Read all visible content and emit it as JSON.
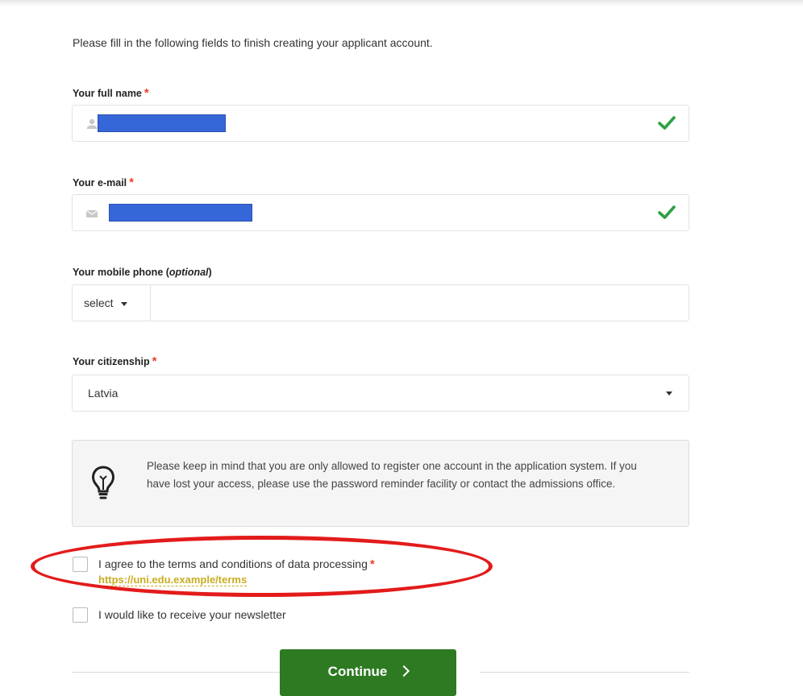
{
  "intro": "Please fill in the following fields to finish creating your applicant account.",
  "required_mark": "*",
  "fullname": {
    "label": "Your full name",
    "status_icon": "check-icon",
    "field_icon": "user-icon"
  },
  "email": {
    "label": "Your e-mail",
    "status_icon": "check-icon",
    "field_icon": "envelope-icon"
  },
  "phone": {
    "label": "Your mobile phone (",
    "label_optional": "optional",
    "label_close": ")",
    "code_select": "select",
    "value": ""
  },
  "citizenship": {
    "label": "Your citizenship",
    "value": "Latvia"
  },
  "info": {
    "icon": "lightbulb-icon",
    "text": "Please keep in mind that you are only allowed to register one account in the application system. If you have lost your access, please use the password reminder facility or contact the admissions office."
  },
  "terms": {
    "label": "I agree to the terms and conditions of data processing",
    "link": "https://uni.edu.example/terms",
    "checked": false
  },
  "newsletter": {
    "label": "I would like to receive your newsletter",
    "checked": false
  },
  "continue_label": "Continue",
  "colors": {
    "required": "#e8412c",
    "check": "#2ea043",
    "continue_bg": "#2d7a22",
    "link": "#c9ad20",
    "annotation": "#e31b1b",
    "redaction": "#3667d9"
  }
}
